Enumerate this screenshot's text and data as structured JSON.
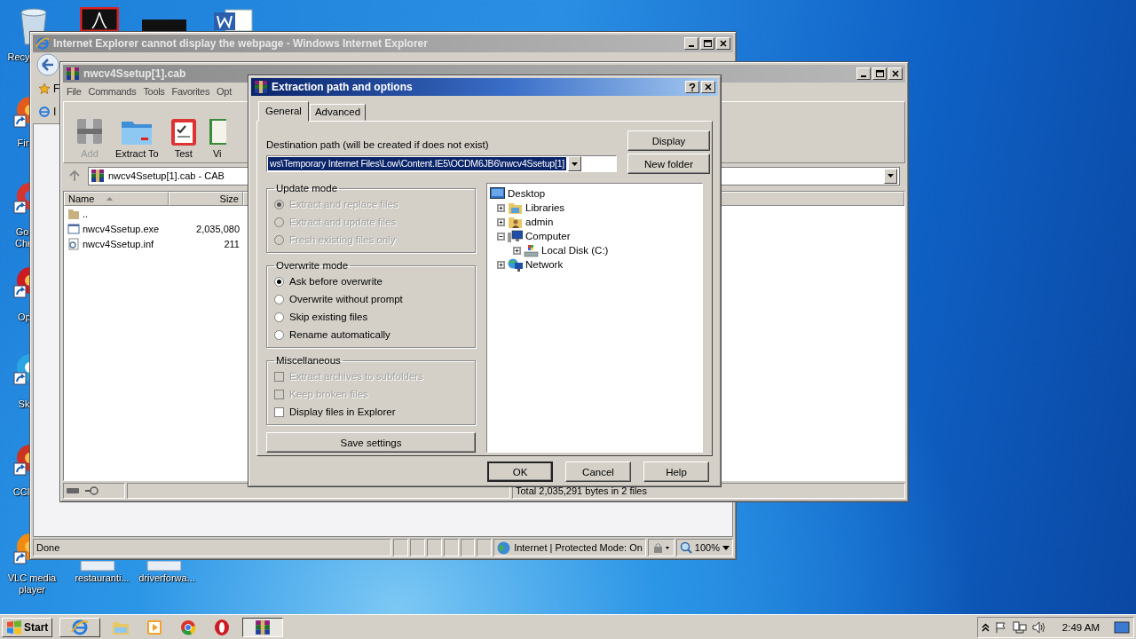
{
  "desktop_icons": [
    {
      "kind": "trash",
      "label": "Recy"
    },
    {
      "kind": "acrobat"
    },
    {
      "kind": "dark"
    },
    {
      "kind": "word"
    },
    {
      "kind": "firefox",
      "label": "Fir"
    },
    {
      "kind": "chrome",
      "label": "Go Chr"
    },
    {
      "kind": "opera",
      "label": "Op"
    },
    {
      "kind": "skype",
      "label": "Sk"
    },
    {
      "kind": "ccleaner",
      "label": "CCl"
    },
    {
      "kind": "vlc",
      "label": "VLC media player"
    },
    {
      "kind": "file",
      "label": "restauranti..."
    },
    {
      "kind": "file",
      "label": "driverforwa..."
    }
  ],
  "browser_window": {
    "title": "Internet Explorer cannot display the webpage - Windows Internet Explorer",
    "favorites_label": "F",
    "tab_label": "I",
    "status_bar": {
      "text": "Done",
      "zone": "Internet | Protected Mode: On",
      "zoom": "100%"
    }
  },
  "archiver_window": {
    "title": "nwcv4Ssetup[1].cab",
    "menu": [
      "File",
      "Commands",
      "Tools",
      "Favorites",
      "Opt"
    ],
    "toolbar": [
      {
        "kind": "add",
        "label": "Add",
        "disabled": true
      },
      {
        "kind": "extract",
        "label": "Extract To",
        "disabled": false
      },
      {
        "kind": "test",
        "label": "Test",
        "disabled": false
      },
      {
        "kind": "view",
        "label": "Vi",
        "disabled": false
      }
    ],
    "address": "nwcv4Ssetup[1].cab - CAB",
    "columns": [
      "Name",
      "Size"
    ],
    "rows": [
      {
        "kind": "up",
        "name": "..",
        "size": ""
      },
      {
        "kind": "exe",
        "name": "nwcv4Ssetup.exe",
        "size": "2,035,080"
      },
      {
        "kind": "inf",
        "name": "nwcv4Ssetup.inf",
        "size": "211"
      }
    ],
    "status": "Total 2,035,291 bytes in 2 files"
  },
  "dialog": {
    "title": "Extraction path and options",
    "tabs": [
      {
        "label": "General",
        "selected": true
      },
      {
        "label": "Advanced",
        "selected": false
      }
    ],
    "destination_label": "Destination path (will be created if does not exist)",
    "destination_value": "ws\\Temporary Internet Files\\Low\\Content.IE5\\OCDM6JB6\\nwcv4Ssetup[1]",
    "side_buttons": [
      "Display",
      "New folder"
    ],
    "update_mode": {
      "title": "Update mode",
      "options": [
        {
          "label": "Extract and replace files",
          "selected": true,
          "disabled": true
        },
        {
          "label": "Extract and update files",
          "selected": false,
          "disabled": true
        },
        {
          "label": "Fresh existing files only",
          "selected": false,
          "disabled": true
        }
      ]
    },
    "overwrite_mode": {
      "title": "Overwrite mode",
      "options": [
        {
          "label": "Ask before overwrite",
          "selected": true,
          "disabled": false
        },
        {
          "label": "Overwrite without prompt",
          "selected": false,
          "disabled": false
        },
        {
          "label": "Skip existing files",
          "selected": false,
          "disabled": false
        },
        {
          "label": "Rename automatically",
          "selected": false,
          "disabled": false
        }
      ]
    },
    "miscellaneous": {
      "title": "Miscellaneous",
      "options": [
        {
          "label": "Extract archives to subfolders",
          "checked": false,
          "disabled": true
        },
        {
          "label": "Keep broken files",
          "checked": false,
          "disabled": true
        },
        {
          "label": "Display files in Explorer",
          "checked": false,
          "disabled": false
        }
      ]
    },
    "save_button": "Save settings",
    "tree": {
      "label": "Desktop",
      "kind": "desktop",
      "children": [
        {
          "label": "Libraries",
          "kind": "library",
          "expanded": false
        },
        {
          "label": "admin",
          "kind": "user",
          "expanded": false
        },
        {
          "label": "Computer",
          "kind": "computer",
          "expanded": true,
          "children": [
            {
              "label": "Local Disk (C:)",
              "kind": "drive",
              "expanded": false
            }
          ]
        },
        {
          "label": "Network",
          "kind": "network",
          "expanded": false
        }
      ]
    },
    "buttons": [
      "OK",
      "Cancel",
      "Help"
    ]
  },
  "taskbar": {
    "start": "Start",
    "apps": [
      {
        "kind": "ie",
        "selected": false
      },
      {
        "kind": "folder",
        "selected": false
      },
      {
        "kind": "media",
        "selected": false
      },
      {
        "kind": "chrome",
        "selected": false
      },
      {
        "kind": "opera",
        "selected": false
      },
      {
        "kind": "archiver",
        "selected": true
      }
    ],
    "clock": "2:49 AM"
  }
}
